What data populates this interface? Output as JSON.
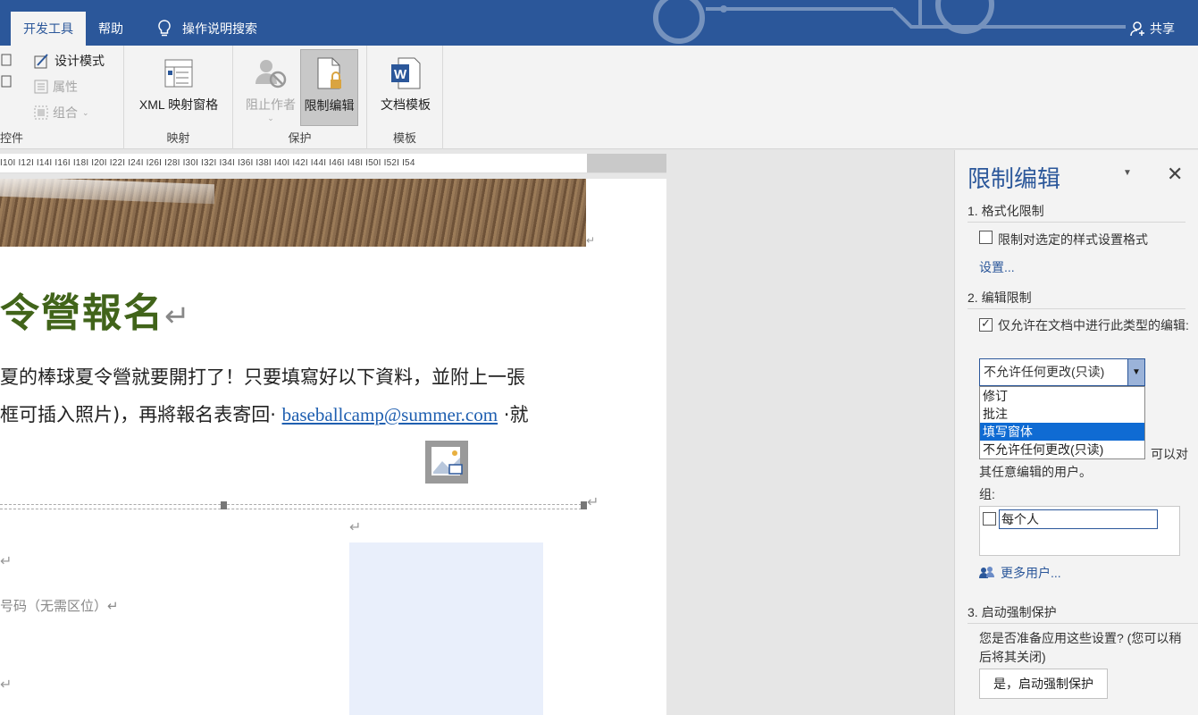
{
  "tabs": {
    "developer": "开发工具",
    "help": "帮助",
    "search": "操作说明搜索",
    "share": "共享"
  },
  "ribbon": {
    "controls": {
      "design_mode": "设计模式",
      "properties": "属性",
      "group": "组合",
      "label": "控件"
    },
    "mapping": {
      "xml_pane": "XML 映射窗格",
      "label": "映射"
    },
    "protect": {
      "block_authors": "阻止作者",
      "restrict_editing": "限制编辑",
      "label": "保护"
    },
    "templates": {
      "document_template": "文档模板",
      "label": "模板"
    }
  },
  "ruler": {
    "marks": "I10I  I12I  I14I  I16I  I18I  I20I  I22I  I24I  I26I  I28I  I30I  I32I  I34I  I36I  I38I  I40I  I42I  I44I  I46I  I48I  I50I  I52I  I54"
  },
  "document": {
    "title": "令營報名",
    "line1": "夏的棒球夏令營就要開打了！只要填寫好以下資料，並附上一張",
    "line2_prefix": "框可插入照片)，再將報名表寄回·",
    "email": "baseballcamp@summer.com",
    "line2_suffix": "·就",
    "phone_label": "号码（无需区位）↵"
  },
  "pane": {
    "title": "限制编辑",
    "section1": "1. 格式化限制",
    "format_restrict": "限制对选定的样式设置格式",
    "settings_link": "设置...",
    "section2": "2. 编辑限制",
    "allow_only": "仅允许在文档中进行此类型的编辑:",
    "select_value": "不允许任何更改(只读)",
    "options": [
      "修订",
      "批注",
      "填写窗体",
      "不允许任何更改(只读)"
    ],
    "selected_option": "填写窗体",
    "exceptions_tail": "可以对",
    "exceptions_desc": "其任意编辑的用户。",
    "groups_label": "组:",
    "everyone": "每个人",
    "more_users": "更多用户...",
    "section3": "3. 启动强制保护",
    "ready_text": "您是否准备应用这些设置? (您可以稍后将其关闭)",
    "start_button": "是，启动强制保护"
  }
}
